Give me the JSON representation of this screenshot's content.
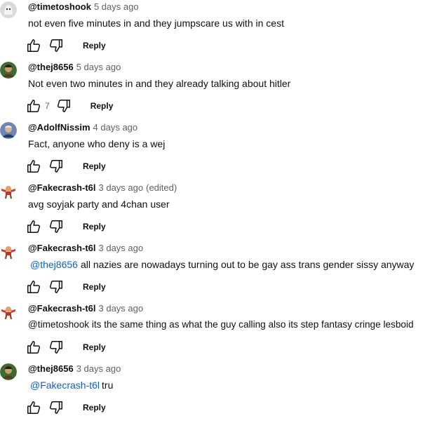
{
  "comments": [
    {
      "author": "@timetoshook",
      "time": "5 days ago",
      "edited": "",
      "mention": "",
      "text": "not even five minutes in and they jumpscare us with in cest",
      "likes": "",
      "reply": "Reply",
      "avatar": "ghost-avatar"
    },
    {
      "author": "@thej8656",
      "time": "5 days ago",
      "edited": "",
      "mention": "",
      "text": "Not even two minutes in and they already talking about hitler",
      "likes": "7",
      "reply": "Reply",
      "avatar": "green-avatar"
    },
    {
      "author": "@AdolfNissim",
      "time": "4 days ago",
      "edited": "",
      "mention": "",
      "text": "Fact, anyone who deny is a wej",
      "likes": "",
      "reply": "Reply",
      "avatar": "blue-avatar"
    },
    {
      "author": "@Fakecrash-t6l",
      "time": "3 days ago",
      "edited": "(edited)",
      "mention": "",
      "text": "avg soyjak party and 4chan user",
      "likes": "",
      "reply": "Reply",
      "avatar": "crash-avatar"
    },
    {
      "author": "@Fakecrash-t6l",
      "time": "3 days ago",
      "edited": "",
      "mention": "@thej8656",
      "text": "all nazies are nowadays turning out to be gay ass trans gender sissy anyway",
      "likes": "",
      "reply": "Reply",
      "avatar": "crash-avatar"
    },
    {
      "author": "@Fakecrash-t6l",
      "time": "3 days ago",
      "edited": "",
      "mention": "",
      "text": "@timetoshook its the same thing as what the guy calling also its step fantasy cringe lesboid",
      "likes": "",
      "reply": "Reply",
      "avatar": "crash-avatar"
    },
    {
      "author": "@thej8656",
      "time": "3 days ago",
      "edited": "",
      "mention": "@Fakecrash-t6l",
      "text": "tru",
      "likes": "",
      "reply": "Reply",
      "avatar": "green-avatar"
    }
  ],
  "icons": {
    "like": "thumbs-up-icon",
    "dislike": "thumbs-down-icon"
  },
  "colors": {
    "mention": "#065fd4",
    "meta": "#606060",
    "text": "#0f0f0f"
  }
}
